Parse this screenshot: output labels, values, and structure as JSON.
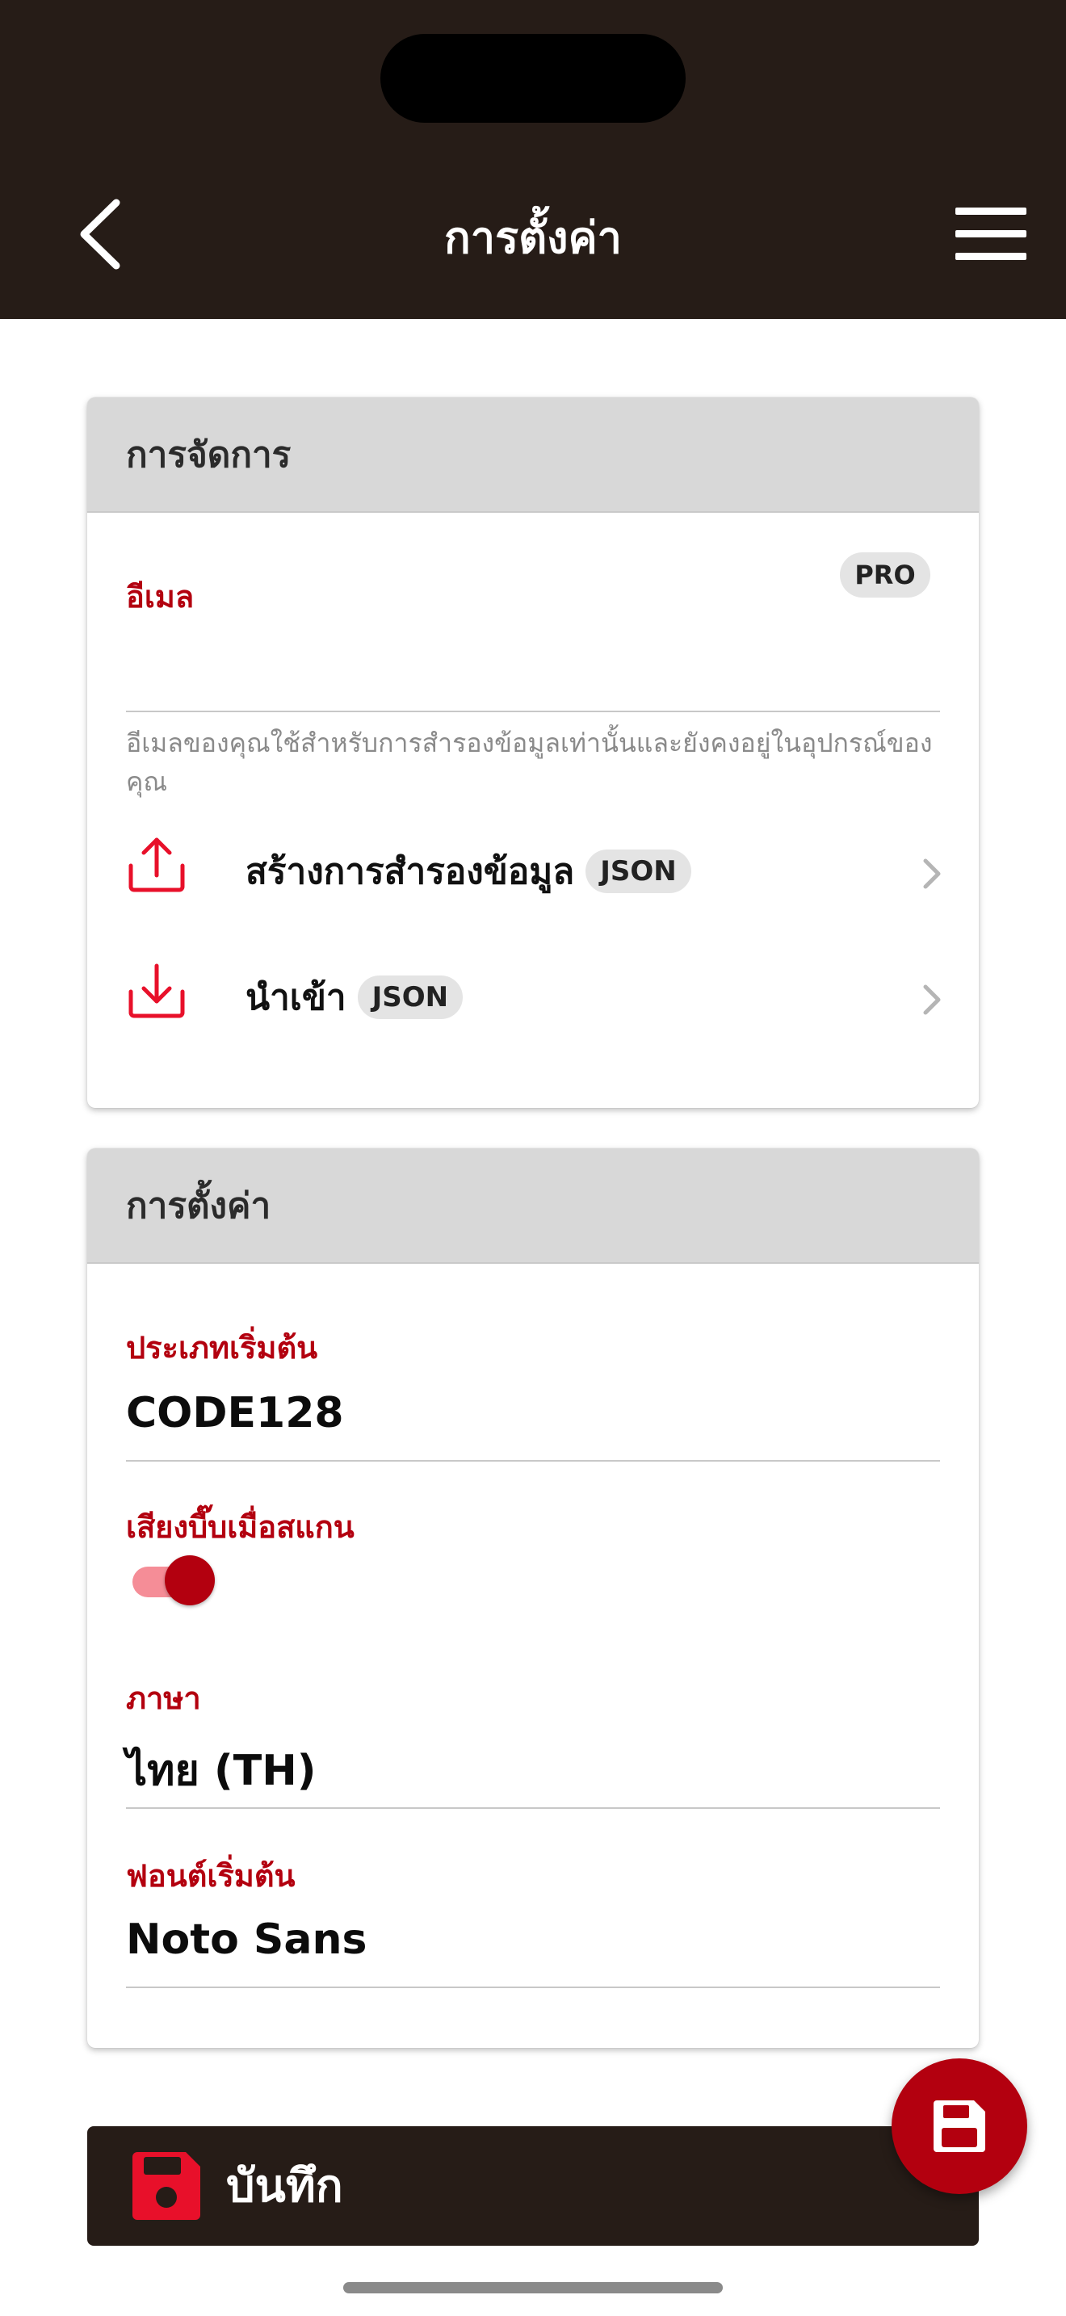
{
  "header": {
    "title": "การตั้งค่า"
  },
  "management_card": {
    "title": "การจัดการ",
    "email_label": "อีเมล",
    "pro_badge": "PRO",
    "email_value": "",
    "helper": "อีเมลของคุณใช้สำหรับการสำรองข้อมูลเท่านั้นและยังคงอยู่ในอุปกรณ์ของคุณ",
    "actions": [
      {
        "label": "สร้างการสำรองข้อมูล",
        "tag": "JSON",
        "icon": "upload-icon"
      },
      {
        "label": "นำเข้า",
        "tag": "JSON",
        "icon": "download-icon"
      }
    ]
  },
  "settings_card": {
    "title": "การตั้งค่า",
    "default_type_label": "ประเภทเริ่มต้น",
    "default_type_value": "CODE128",
    "beep_label": "เสียงบี๊บเมื่อสแกน",
    "beep_enabled": true,
    "language_label": "ภาษา",
    "language_value": "ไทย (TH)",
    "font_label": "ฟอนต์เริ่มต้น",
    "font_value": "Noto Sans"
  },
  "save_bar": {
    "label": "บันทึก",
    "icon": "floppy-disk-icon"
  },
  "fab": {
    "icon": "floppy-disk-icon"
  },
  "colors": {
    "header_bg": "#261c17",
    "accent_red": "#b3000f",
    "icon_red": "#e8102a",
    "toggle_track": "#f58d97",
    "card_header_bg": "#d8d8d8"
  }
}
